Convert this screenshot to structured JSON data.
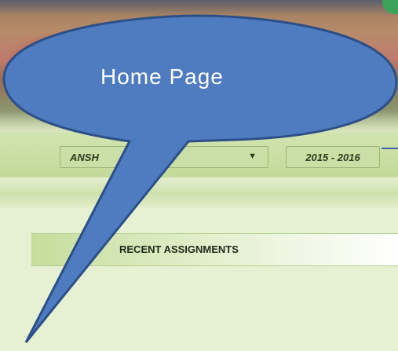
{
  "header": {
    "student_selector": {
      "value": "ANSH",
      "arrow_icon": "chevron-down-icon"
    },
    "year_selector": {
      "value": "2015 - 2016"
    }
  },
  "main": {
    "section_title": "RECENT ASSIGNMENTS"
  },
  "annotation": {
    "callout_text": "Home Page",
    "fill_color": "#4f7cc0",
    "stroke_color": "#2d4f87"
  }
}
